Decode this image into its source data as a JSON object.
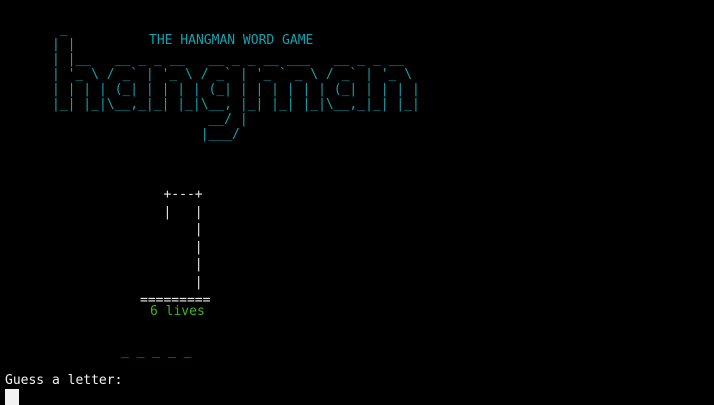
{
  "terminal": {
    "title": "THE HANGMAN WORD GAME",
    "banner_ascii": " _\n| |\n| |__   __ _ _ __   __ _ _ __ ___   __ _ _ __\n| '_ \\ / _` | '_ \\ / _` | '_ ` _ \\ / _` | '_ \\\n| | | | (_| | | | | (_| | | | | | | (_| | | | |\n|_| |_|\\__,_|_| |_|\\__, |_| |_| |_|\\__,_|_| |_|\n                    __/ |\n                   |___/",
    "gallows_ascii": "   +---+\n   |   |\n       |\n       |\n       |\n       |\n=========",
    "lives": "6 lives",
    "word_blanks": "_ _ _ _ _",
    "prompt": "Guess a letter:"
  },
  "colors": {
    "background": "#000000",
    "cyan": "#0fa3b1",
    "green": "#3db61a",
    "white": "#f2f2f2"
  }
}
